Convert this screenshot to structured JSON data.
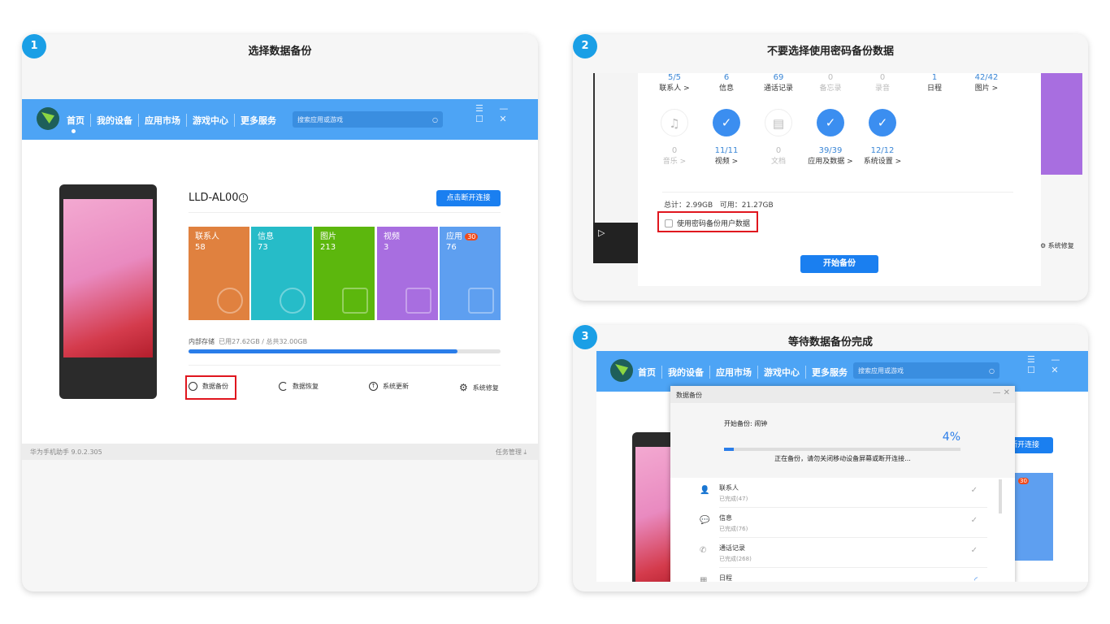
{
  "steps": [
    {
      "number": "1",
      "title": "选择数据备份"
    },
    {
      "number": "2",
      "title": "不要选择使用密码备份数据"
    },
    {
      "number": "3",
      "title": "等待数据备份完成"
    }
  ],
  "nav": {
    "items": [
      "首页",
      "我的设备",
      "应用市场",
      "游戏中心",
      "更多服务"
    ],
    "search_placeholder": "搜索应用或游戏",
    "window_controls": "☰ — ☐ ✕"
  },
  "device": {
    "name": "LLD-AL00",
    "disconnect_label": "点击断开连接",
    "tiles": [
      {
        "label": "联系人",
        "count": "58",
        "color": "#e0813f"
      },
      {
        "label": "信息",
        "count": "73",
        "color": "#26bcc8"
      },
      {
        "label": "图片",
        "count": "213",
        "color": "#5cb70d"
      },
      {
        "label": "视频",
        "count": "3",
        "color": "#a86ee0"
      },
      {
        "label": "应用",
        "count": "76",
        "badge": "30",
        "color": "#5e9ff0"
      }
    ],
    "storage_label": "内部存储",
    "storage_text": "已用27.62GB / 总共32.00GB",
    "storage_used_fraction": 0.863,
    "actions": [
      "数据备份",
      "数据恢复",
      "系统更新",
      "系统修复"
    ]
  },
  "footer": {
    "version": "华为手机助手 9.0.2.305",
    "tasks": "任务管理"
  },
  "backup_select": {
    "row1": [
      {
        "n": "5/5",
        "l": "联系人 >"
      },
      {
        "n": "6",
        "l": "信息"
      },
      {
        "n": "69",
        "l": "通话记录"
      },
      {
        "n": "0",
        "l": "备忘录",
        "dim": true
      },
      {
        "n": "0",
        "l": "录音",
        "dim": true
      },
      {
        "n": "1",
        "l": "日程"
      },
      {
        "n": "42/42",
        "l": "图片 >"
      }
    ],
    "row2": [
      {
        "n": "0",
        "l": "音乐 >",
        "dim": true,
        "checked": false
      },
      {
        "n": "11/11",
        "l": "视频 >",
        "checked": true
      },
      {
        "n": "0",
        "l": "文档",
        "dim": true,
        "checked": false
      },
      {
        "n": "39/39",
        "l": "应用及数据 >",
        "checked": true
      },
      {
        "n": "12/12",
        "l": "系统设置 >",
        "checked": true
      }
    ],
    "total": "总计：2.99GB",
    "available": "可用：21.27GB",
    "password_checkbox": "使用密码备份用户数据",
    "password_checked": false,
    "start_button": "开始备份",
    "side_action": "系统修复"
  },
  "progress_dialog": {
    "title": "数据备份",
    "current": "开始备份: 闹钟",
    "percent_text": "4%",
    "percent": 4,
    "warning": "正在备份，请勿关闭移动设备屏幕或断开连接...",
    "items": [
      {
        "name": "联系人",
        "status": "已完成(47)",
        "done": true
      },
      {
        "name": "信息",
        "status": "已完成(76)",
        "done": true
      },
      {
        "name": "通话记录",
        "status": "已完成(268)",
        "done": true
      },
      {
        "name": "日程",
        "status": "",
        "done": false
      }
    ],
    "bg_button": "断开连接",
    "bg_badge": "30"
  }
}
